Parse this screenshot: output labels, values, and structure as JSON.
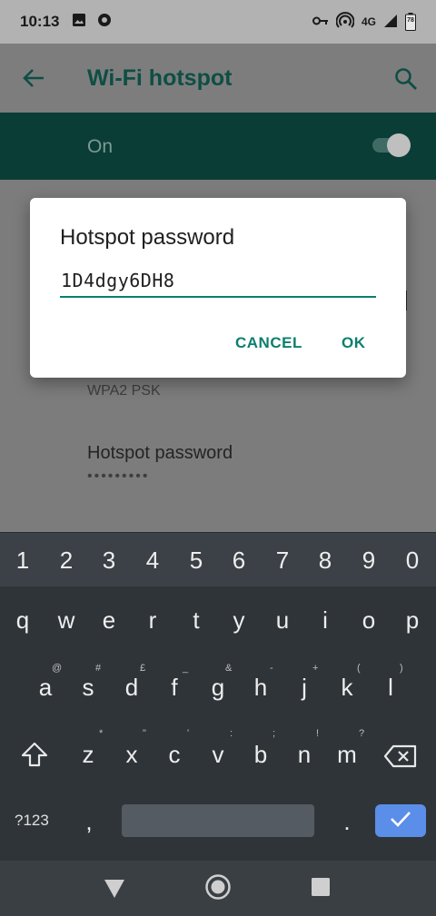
{
  "status_bar": {
    "time": "10:13",
    "network": "4G",
    "battery": "78"
  },
  "app_bar": {
    "title": "Wi-Fi hotspot"
  },
  "toggle": {
    "label": "On",
    "state": true
  },
  "settings": {
    "security_value": "WPA2 PSK",
    "password_title": "Hotspot password",
    "password_masked": "•••••••••"
  },
  "dialog": {
    "title": "Hotspot password",
    "input_value": "1D4dgy6DH8",
    "cancel_label": "CANCEL",
    "ok_label": "OK"
  },
  "keyboard": {
    "numbers": [
      "1",
      "2",
      "3",
      "4",
      "5",
      "6",
      "7",
      "8",
      "9",
      "0"
    ],
    "row1": [
      "q",
      "w",
      "e",
      "r",
      "t",
      "y",
      "u",
      "i",
      "o",
      "p"
    ],
    "row2": [
      "a",
      "s",
      "d",
      "f",
      "g",
      "h",
      "j",
      "k",
      "l"
    ],
    "row2_sub": [
      "@",
      "#",
      "£",
      "_",
      "&",
      "-",
      "+",
      "(",
      ")"
    ],
    "row3": [
      "z",
      "x",
      "c",
      "v",
      "b",
      "n",
      "m"
    ],
    "row3_sub": [
      "*",
      "\"",
      "'",
      ":",
      ";",
      "!",
      "?"
    ],
    "symbols_label": "?123",
    "comma": ",",
    "period": "."
  },
  "colors": {
    "accent": "#0b7f6e",
    "enter_key": "#5b8ee8"
  }
}
